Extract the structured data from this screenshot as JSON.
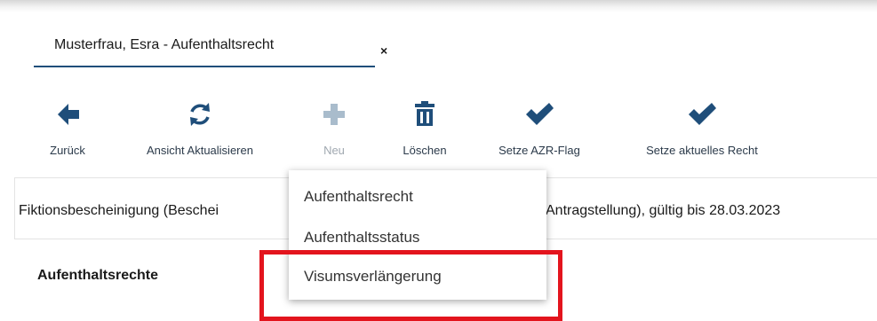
{
  "tab": {
    "title": "Musterfrau, Esra - Aufenthaltsrecht",
    "close_label": "×"
  },
  "toolbar": {
    "items": [
      {
        "label": "Zurück",
        "icon": "arrow-left-icon",
        "enabled": true
      },
      {
        "label": "Ansicht Aktualisieren",
        "icon": "refresh-icon",
        "enabled": true
      },
      {
        "label": "Neu",
        "icon": "plus-icon",
        "enabled": false
      },
      {
        "label": "Löschen",
        "icon": "trash-icon",
        "enabled": true
      },
      {
        "label": "Setze AZR-Flag",
        "icon": "checkmark-icon",
        "enabled": true
      },
      {
        "label": "Setze aktuelles Recht",
        "icon": "checkmark-icon",
        "enabled": true
      }
    ]
  },
  "info": {
    "text_left": "Fiktionsbescheinigung (Beschei",
    "text_right": "Antragstellung), gültig bis 28.03.2023"
  },
  "section": {
    "title": "Aufenthaltsrechte"
  },
  "dropdown": {
    "items": [
      "Aufenthaltsrecht",
      "Aufenthaltsstatus",
      "Visumsverlängerung"
    ]
  },
  "colors": {
    "icon_dark": "#1f4e7a",
    "icon_disabled": "#a9bccc",
    "tab_underline": "#1f4e7a",
    "highlight": "#e3141d"
  }
}
